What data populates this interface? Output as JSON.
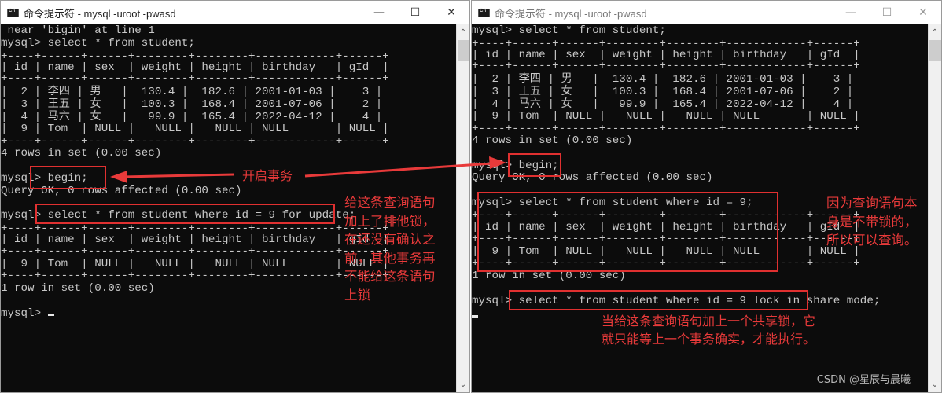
{
  "left_window": {
    "title": "命令提示符 - mysql  -uroot -pwasd",
    "controls": {
      "minimize": "—",
      "maximize": "☐",
      "close": "✕"
    },
    "lines": [
      " near 'bigin' at line 1",
      "mysql> select * from student;",
      "+----+------+------+--------+--------+------------+------+",
      "| id | name | sex  | weight | height | birthday   | gId  |",
      "+----+------+------+--------+--------+------------+------+",
      "|  2 | 李四 | 男   |  130.4 |  182.6 | 2001-01-03 |    3 |",
      "|  3 | 王五 | 女   |  100.3 |  168.4 | 2001-07-06 |    2 |",
      "|  4 | 马六 | 女   |   99.9 |  165.4 | 2022-04-12 |    4 |",
      "|  9 | Tom  | NULL |   NULL |   NULL | NULL       | NULL |",
      "+----+------+------+--------+--------+------------+------+",
      "4 rows in set (0.00 sec)",
      "",
      "mysql> begin;",
      "Query OK, 0 rows affected (0.00 sec)",
      "",
      "mysql> select * from student where id = 9 for update;",
      "+----+------+------+--------+--------+------------+------+",
      "| id | name | sex  | weight | height | birthday   | gId  |",
      "+----+------+------+--------+--------+------------+------+",
      "|  9 | Tom  | NULL |   NULL |   NULL | NULL       | NULL |",
      "+----+------+------+--------+--------+------------+------+",
      "1 row in set (0.00 sec)",
      "",
      "mysql> "
    ],
    "annotations": {
      "begin_label": "开启事务",
      "for_update_note": "给这条查询语句\n加上了排他锁，\n在还没有确认之\n前，其他事务再\n不能给这条语句\n上锁"
    }
  },
  "right_window": {
    "title": "命令提示符 - mysql  -uroot -pwasd",
    "controls": {
      "minimize": "—",
      "maximize": "☐",
      "close": "✕"
    },
    "lines": [
      "mysql> select * from student;",
      "+----+------+------+--------+--------+------------+------+",
      "| id | name | sex  | weight | height | birthday   | gId  |",
      "+----+------+------+--------+--------+------------+------+",
      "|  2 | 李四 | 男   |  130.4 |  182.6 | 2001-01-03 |    3 |",
      "|  3 | 王五 | 女   |  100.3 |  168.4 | 2001-07-06 |    2 |",
      "|  4 | 马六 | 女   |   99.9 |  165.4 | 2022-04-12 |    4 |",
      "|  9 | Tom  | NULL |   NULL |   NULL | NULL       | NULL |",
      "+----+------+------+--------+--------+------------+------+",
      "4 rows in set (0.00 sec)",
      "",
      "mysql> begin;",
      "Query OK, 0 rows affected (0.00 sec)",
      "",
      "mysql> select * from student where id = 9;",
      "+----+------+------+--------+--------+------------+------+",
      "| id | name | sex  | weight | height | birthday   | gId  |",
      "+----+------+------+--------+--------+------------+------+",
      "|  9 | Tom  | NULL |   NULL |   NULL | NULL       | NULL |",
      "+----+------+------+--------+--------+------------+------+",
      "1 row in set (0.00 sec)",
      "",
      "mysql> select * from student where id = 9 lock in share mode;"
    ],
    "annotations": {
      "no_lock_note": "因为查询语句本\n身是不带锁的，\n所以可以查询。",
      "share_lock_note": "当给这条查询语句加上一个共享锁，它\n就只能等上一个事务确实，才能执行。"
    },
    "watermark": "CSDN @星辰与晨曦"
  },
  "colors": {
    "console_bg": "#0c0c0c",
    "console_text": "#c8c8c8",
    "annotation_red": "#e83a3a"
  }
}
